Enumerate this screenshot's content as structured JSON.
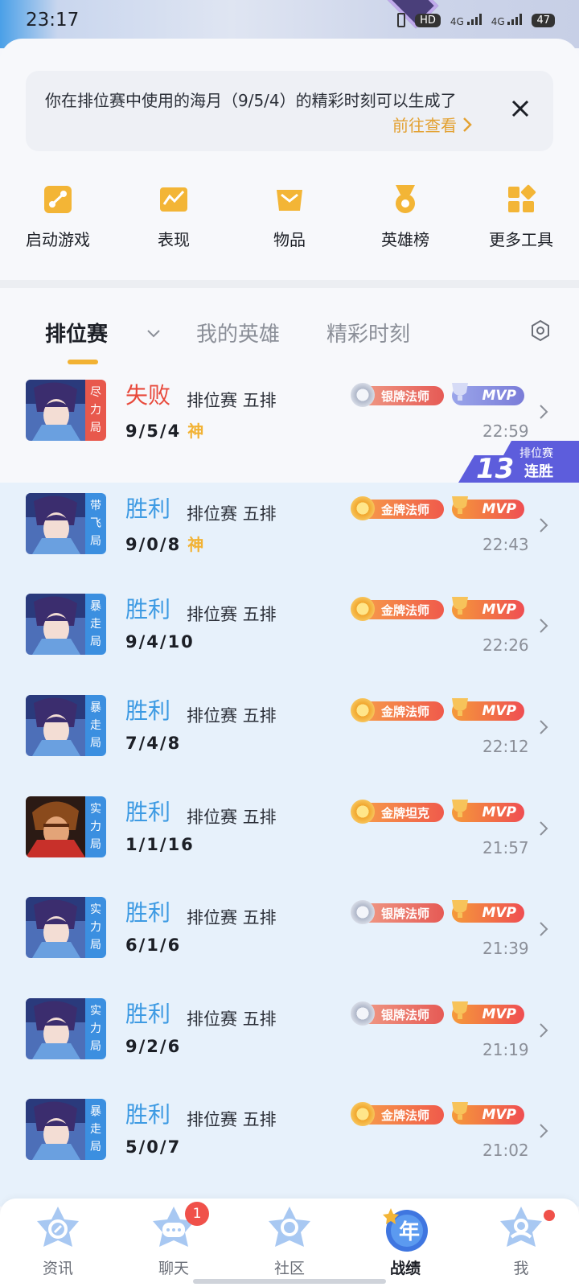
{
  "status_bar": {
    "time": "23:17",
    "hd": "HD",
    "net1": "4G",
    "net2": "4G",
    "battery": "47"
  },
  "notice": {
    "text": "你在排位赛中使用的海月（9/5/4）的精彩时刻可以生成了",
    "link": "前往查看",
    "close_icon": "close-icon"
  },
  "tools": [
    {
      "label": "启动游戏",
      "icon": "gamepad-icon"
    },
    {
      "label": "表现",
      "icon": "chart-icon"
    },
    {
      "label": "物品",
      "icon": "box-icon"
    },
    {
      "label": "英雄榜",
      "icon": "medal-icon"
    },
    {
      "label": "更多工具",
      "icon": "grid-icon"
    }
  ],
  "tabs": {
    "ranked": "排位赛",
    "my_heroes": "我的英雄",
    "highlights": "精彩时刻"
  },
  "streak": {
    "label_top": "排位赛",
    "count": "13",
    "label_bottom": "连胜"
  },
  "matches": [
    {
      "tag": [
        "尽",
        "力",
        "局"
      ],
      "tag_color": "#e8584c",
      "result": "失败",
      "result_type": "lose",
      "mode": "排位赛 五排",
      "kda": "9/5/4",
      "god": "神",
      "medal": "银牌法师",
      "medal_type": "silver",
      "mvp": "MVP",
      "mvp_type": "silver",
      "time": "22:59",
      "hero": "blue"
    },
    {
      "tag": [
        "带",
        "飞",
        "局"
      ],
      "tag_color": "#3b8fe0",
      "result": "胜利",
      "result_type": "win",
      "mode": "排位赛 五排",
      "kda": "9/0/8",
      "god": "神",
      "medal": "金牌法师",
      "medal_type": "gold",
      "mvp": "MVP",
      "mvp_type": "gold",
      "time": "22:43",
      "hero": "blue"
    },
    {
      "tag": [
        "暴",
        "走",
        "局"
      ],
      "tag_color": "#3b8fe0",
      "result": "胜利",
      "result_type": "win",
      "mode": "排位赛 五排",
      "kda": "9/4/10",
      "god": "",
      "medal": "金牌法师",
      "medal_type": "gold",
      "mvp": "MVP",
      "mvp_type": "gold",
      "time": "22:26",
      "hero": "blue"
    },
    {
      "tag": [
        "暴",
        "走",
        "局"
      ],
      "tag_color": "#3b8fe0",
      "result": "胜利",
      "result_type": "win",
      "mode": "排位赛 五排",
      "kda": "7/4/8",
      "god": "",
      "medal": "金牌法师",
      "medal_type": "gold",
      "mvp": "MVP",
      "mvp_type": "gold",
      "time": "22:12",
      "hero": "blue"
    },
    {
      "tag": [
        "实",
        "力",
        "局"
      ],
      "tag_color": "#3b8fe0",
      "result": "胜利",
      "result_type": "win",
      "mode": "排位赛 五排",
      "kda": "1/1/16",
      "god": "",
      "medal": "金牌坦克",
      "medal_type": "gold",
      "mvp": "MVP",
      "mvp_type": "gold",
      "time": "21:57",
      "hero": "red"
    },
    {
      "tag": [
        "实",
        "力",
        "局"
      ],
      "tag_color": "#3b8fe0",
      "result": "胜利",
      "result_type": "win",
      "mode": "排位赛 五排",
      "kda": "6/1/6",
      "god": "",
      "medal": "银牌法师",
      "medal_type": "silver",
      "mvp": "MVP",
      "mvp_type": "gold",
      "time": "21:39",
      "hero": "blue"
    },
    {
      "tag": [
        "实",
        "力",
        "局"
      ],
      "tag_color": "#3b8fe0",
      "result": "胜利",
      "result_type": "win",
      "mode": "排位赛 五排",
      "kda": "9/2/6",
      "god": "",
      "medal": "银牌法师",
      "medal_type": "silver",
      "mvp": "MVP",
      "mvp_type": "gold",
      "time": "21:19",
      "hero": "blue"
    },
    {
      "tag": [
        "暴",
        "走",
        "局"
      ],
      "tag_color": "#3b8fe0",
      "result": "胜利",
      "result_type": "win",
      "mode": "排位赛 五排",
      "kda": "5/0/7",
      "god": "",
      "medal": "金牌法师",
      "medal_type": "gold",
      "mvp": "MVP",
      "mvp_type": "gold",
      "time": "21:02",
      "hero": "blue"
    }
  ],
  "bottom_nav": [
    {
      "label": "资讯",
      "icon": "news-icon",
      "badge": "",
      "dot": false,
      "active": false
    },
    {
      "label": "聊天",
      "icon": "chat-icon",
      "badge": "1",
      "dot": false,
      "active": false
    },
    {
      "label": "社区",
      "icon": "community-icon",
      "badge": "",
      "dot": false,
      "active": false
    },
    {
      "label": "战绩",
      "icon": "record-icon",
      "badge": "",
      "dot": false,
      "active": true,
      "icon_text": "年"
    },
    {
      "label": "我",
      "icon": "profile-icon",
      "badge": "",
      "dot": true,
      "active": false
    }
  ]
}
